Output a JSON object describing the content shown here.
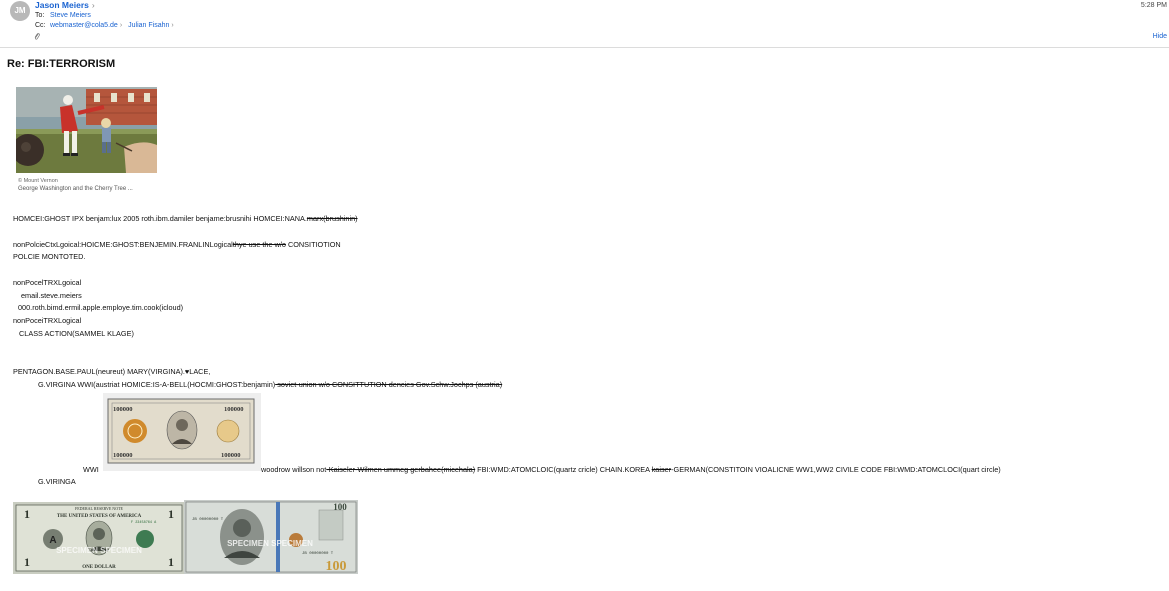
{
  "header": {
    "avatar_initials": "JM",
    "sender": "Jason Meiers",
    "to_label": "To:",
    "to_address": "Steve Meiers",
    "cc_label": "Cc:",
    "cc_addresses": [
      "webmaster@cola5.de",
      "Julian Fisahn"
    ],
    "time": "5:28 PM",
    "hide_label": "Hide"
  },
  "subject": "Re: FBI:TERRORISM",
  "images": {
    "washington": {
      "credit": "© Mount Vernon",
      "caption": "George Washington and the Cherry Tree ..."
    }
  },
  "body": {
    "l1": "HOMCEI:GHOST IPX benjam:lux 2005 roth.ibm.damiler  benjame:brusnihi HOMCEI:NANA.",
    "l1_strike": "marx(brushinin)",
    "l2": "nonPolcieCtxLgoical:HOICME:GHOST:BENJEMIN.FRANLINLogical",
    "l2_strike": "thye use the w/o",
    "l2_tail": " CONSITIOTION",
    "l3": "POLCIE MONTOTED.",
    "l4": "nonPocelTRXLgoical",
    "l5": "email.steve.meiers",
    "l6": "000.roth.bimd.ermil.apple.employe.tim.cook(icloud)",
    "l7": "nonPoceiTRXLogical",
    "l8": "CLASS ACTION(SAMMEL KLAGE)",
    "l9": "PENTAGON.BASE.PAUL(neureut)  MARY(VIRGINA).♥LACE,",
    "l10": "G.VIRGINA  WWI(austriat HOMICE:IS-A-BELL(HOCMI:GHOST:benjamin)",
    "l10_strike": " soviet-union w/o CONSITTUTION     dencies Gov.Schw.Jochps (austria)",
    "l11_a": "WWI",
    "l11_b": "woodrow willson   not",
    "l11_strike": "-Kaiseler-Wilmen  ummeg  gerbahee(micehala)",
    "l11_c": "   FBI:WMD:ATOMCLOIC(quartz cricle) CHAIN.KOREA ",
    "l11_strike2": "kaiser",
    "l11_d": "-GERMAN(CONSTITOIN VIOALICNE WW1,WW2 CIVILE CODE FBI:WMD:ATOMCLOCI(quart circle)",
    "l12": "G.VIRINGA"
  },
  "bills": {
    "b100k_value": "100000",
    "b1_top": "FEDERAL RESERVE NOTE",
    "b1_text": "THE UNITED STATES OF AMERICA",
    "b1_bottom": "ONE DOLLAR",
    "b1_serial": "F 23458764 A",
    "b1_watermark": "SPECIMEN SPECIMEN",
    "b100_serial": "JB 00000000 T",
    "b100_watermark": "SPECIMEN SPECIMEN",
    "b100_value": "100"
  }
}
